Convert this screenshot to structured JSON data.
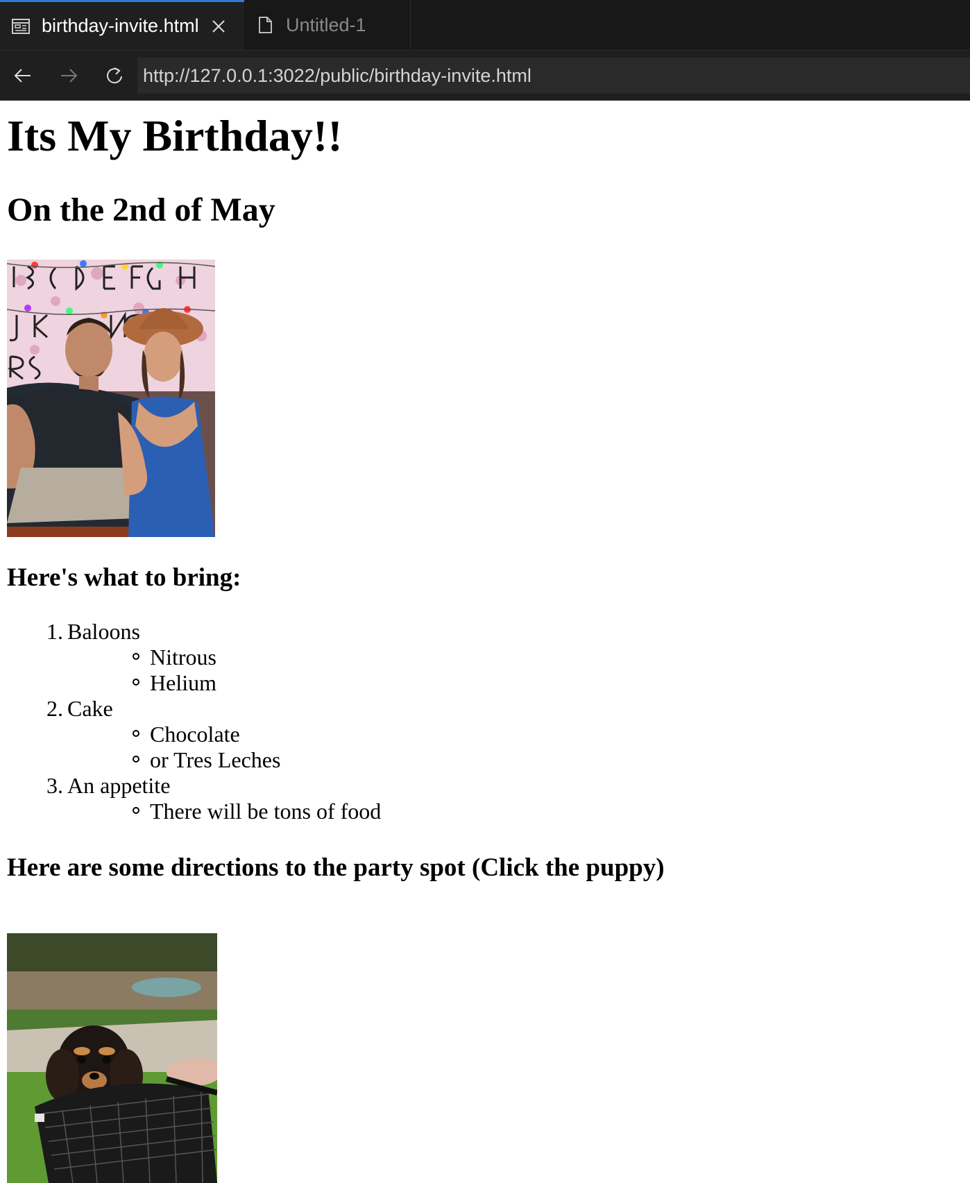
{
  "browser": {
    "tabs": [
      {
        "label": "birthday-invite.html",
        "icon": "preview-icon",
        "active": true
      },
      {
        "label": "Untitled-1",
        "icon": "file-icon",
        "active": false
      }
    ],
    "url": "http://127.0.0.1:3022/public/birthday-invite.html"
  },
  "page": {
    "title": "Its My Birthday!!",
    "date": "On the 2nd of May",
    "bring_heading": "Here's what to bring:",
    "items": [
      {
        "num": "1.",
        "label": "Baloons",
        "subs": [
          "Nitrous",
          "Helium"
        ]
      },
      {
        "num": "2.",
        "label": "Cake",
        "subs": [
          "Chocolate",
          "or Tres Leches"
        ]
      },
      {
        "num": "3.",
        "label": "An appetite",
        "subs": [
          "There will be tons of food"
        ]
      }
    ],
    "directions_heading": "Here are some directions to the party spot (Click the puppy)"
  },
  "colors": {
    "tab_accent": "#2f7bd8",
    "chrome_bg": "#1f1f1f"
  }
}
